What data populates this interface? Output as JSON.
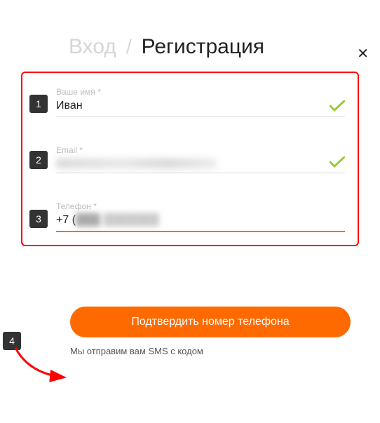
{
  "close_icon": "✕",
  "tabs": {
    "login": "Вход",
    "separator": "/",
    "register": "Регистрация"
  },
  "fields": {
    "name": {
      "step": "1",
      "label": "Ваше имя *",
      "value": "Иван"
    },
    "email": {
      "step": "2",
      "label": "Email *",
      "value": "████████████"
    },
    "phone": {
      "step": "3",
      "label": "Телефон *",
      "prefix": "+7 (",
      "mid": "███)",
      "rest": " ███████"
    }
  },
  "step4": "4",
  "submit_label": "Подтвердить номер телефона",
  "sms_note": "Мы отправим вам SMS с кодом"
}
